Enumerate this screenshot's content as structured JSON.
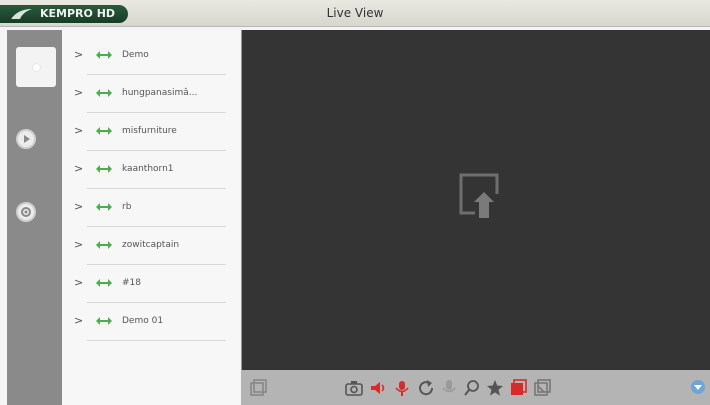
{
  "app": {
    "brand": "KEMPRO HD",
    "title": "Live View"
  },
  "devices": [
    {
      "name": "Demo"
    },
    {
      "name": "hungpanasimâ..."
    },
    {
      "name": "misfurniture"
    },
    {
      "name": "kaanthorn1"
    },
    {
      "name": "rb"
    },
    {
      "name": "zowitcaptain"
    },
    {
      "name": "#18"
    },
    {
      "name": "Demo 01"
    }
  ],
  "sidebar": {
    "items": [
      "live-view",
      "playback",
      "settings"
    ]
  },
  "toolbar": {
    "icons": [
      "layout",
      "snapshot",
      "audio",
      "talk",
      "refresh",
      "microphone",
      "zoom",
      "favorite",
      "record",
      "stop",
      "scroll-down"
    ]
  },
  "colors": {
    "brand_bg": "#1f4a30",
    "connected": "#4cae4c",
    "viewport": "#343434",
    "alert": "#d92a2a"
  }
}
